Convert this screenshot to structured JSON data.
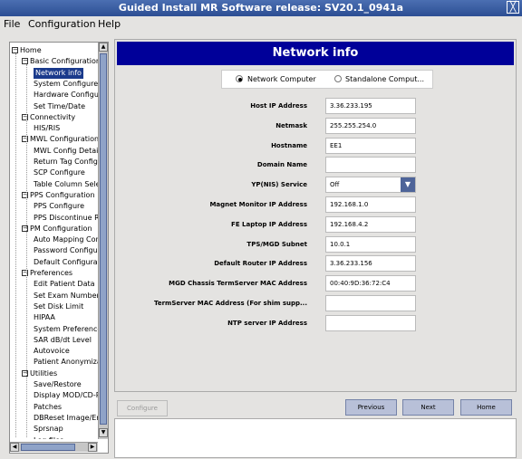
{
  "window": {
    "title": "Guided Install  MR Software release: SV20.1_0941a",
    "close": "╳"
  },
  "menu": [
    "File",
    "Configuration",
    "Help"
  ],
  "tree": [
    {
      "label": "Home",
      "exp": "⊟"
    },
    {
      "label": "Basic Configuration",
      "exp": "⊟"
    },
    {
      "label": "Network info",
      "selected": true
    },
    {
      "label": "System Configure"
    },
    {
      "label": "Hardware Configure"
    },
    {
      "label": "Set Time/Date"
    },
    {
      "label": "Connectivity",
      "exp": "⊟"
    },
    {
      "label": "HIS/RIS"
    },
    {
      "label": "MWL Configuration",
      "exp": "⊟"
    },
    {
      "label": "MWL Config Details"
    },
    {
      "label": "Return Tag Configure"
    },
    {
      "label": "SCP Configure"
    },
    {
      "label": "Table Column Select"
    },
    {
      "label": "PPS Configuration",
      "exp": "⊟"
    },
    {
      "label": "PPS Configure"
    },
    {
      "label": "PPS Discontinue Reason"
    },
    {
      "label": "PM Configuration",
      "exp": "⊟"
    },
    {
      "label": "Auto Mapping Config"
    },
    {
      "label": "Password Configure"
    },
    {
      "label": "Default Configuration"
    },
    {
      "label": "Preferences",
      "exp": "⊟"
    },
    {
      "label": "Edit Patient Data"
    },
    {
      "label": "Set Exam Number"
    },
    {
      "label": "Set Disk Limit"
    },
    {
      "label": "HIPAA"
    },
    {
      "label": "System Preferences"
    },
    {
      "label": "SAR dB/dt Level"
    },
    {
      "label": "Autovoice"
    },
    {
      "label": "Patient Anonymization"
    },
    {
      "label": "Utilities",
      "exp": "⊟"
    },
    {
      "label": "Save/Restore"
    },
    {
      "label": "Display MOD/CD-ROM"
    },
    {
      "label": "Patches"
    },
    {
      "label": "DBReset Image/Error"
    },
    {
      "label": "Sprsnap"
    },
    {
      "label": "Log files"
    }
  ],
  "scroll": {
    "up": "▲",
    "down": "▼",
    "left": "◀",
    "right": "▶"
  },
  "panel": {
    "title": "Network info",
    "radio_network": "Network Computer",
    "radio_standalone": "Standalone Comput...",
    "fields": [
      {
        "label": "Host IP Address",
        "value": "3.36.233.195"
      },
      {
        "label": "Netmask",
        "value": "255.255.254.0"
      },
      {
        "label": "Hostname",
        "value": "EE1"
      },
      {
        "label": "Domain Name",
        "value": ""
      },
      {
        "label": "YP(NIS) Service",
        "value": "Off",
        "select": true
      },
      {
        "label": "Magnet Monitor IP Address",
        "value": "192.168.1.0"
      },
      {
        "label": "FE Laptop IP Address",
        "value": "192.168.4.2"
      },
      {
        "label": "TPS/MGD Subnet",
        "value": "10.0.1"
      },
      {
        "label": "Default Router IP Address",
        "value": "3.36.233.156"
      },
      {
        "label": "MGD Chassis TermServer MAC Address",
        "value": "00:40:9D:36:72:C4"
      },
      {
        "label": "TermServer MAC Address (For shim supp...",
        "value": ""
      },
      {
        "label": "NTP server IP Address",
        "value": ""
      }
    ],
    "select_arrow": "▼"
  },
  "buttons": {
    "configure": "Configure",
    "previous": "Previous",
    "next": "Next",
    "home": "Home"
  }
}
